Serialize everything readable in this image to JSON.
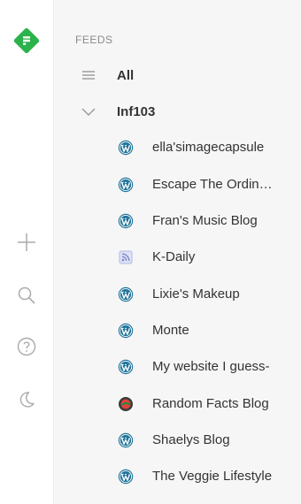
{
  "colors": {
    "brand": "#2bb24c",
    "wordpress": "#21759b",
    "rss": "#7b86c8"
  },
  "sidebar": {
    "section_label": "FEEDS",
    "all_label": "All",
    "category": {
      "label": "Inf103",
      "expanded": true
    },
    "feeds": [
      {
        "label": "ella'simagecapsule",
        "icon": "wordpress-icon"
      },
      {
        "label": "Escape The Ordin…",
        "icon": "wordpress-icon"
      },
      {
        "label": "Fran's Music Blog",
        "icon": "wordpress-icon"
      },
      {
        "label": "K-Daily",
        "icon": "rss-icon"
      },
      {
        "label": "Lixie's Makeup",
        "icon": "wordpress-icon"
      },
      {
        "label": "Monte",
        "icon": "wordpress-icon"
      },
      {
        "label": "My website I guess-",
        "icon": "wordpress-icon"
      },
      {
        "label": "Random Facts Blog",
        "icon": "site-favicon-icon"
      },
      {
        "label": "Shaelys Blog",
        "icon": "wordpress-icon"
      },
      {
        "label": "The Veggie Lifestyle",
        "icon": "wordpress-icon"
      }
    ]
  },
  "rail": {
    "icons": [
      "feedly-logo-icon",
      "add-icon",
      "search-icon",
      "help-icon",
      "night-mode-icon"
    ]
  }
}
